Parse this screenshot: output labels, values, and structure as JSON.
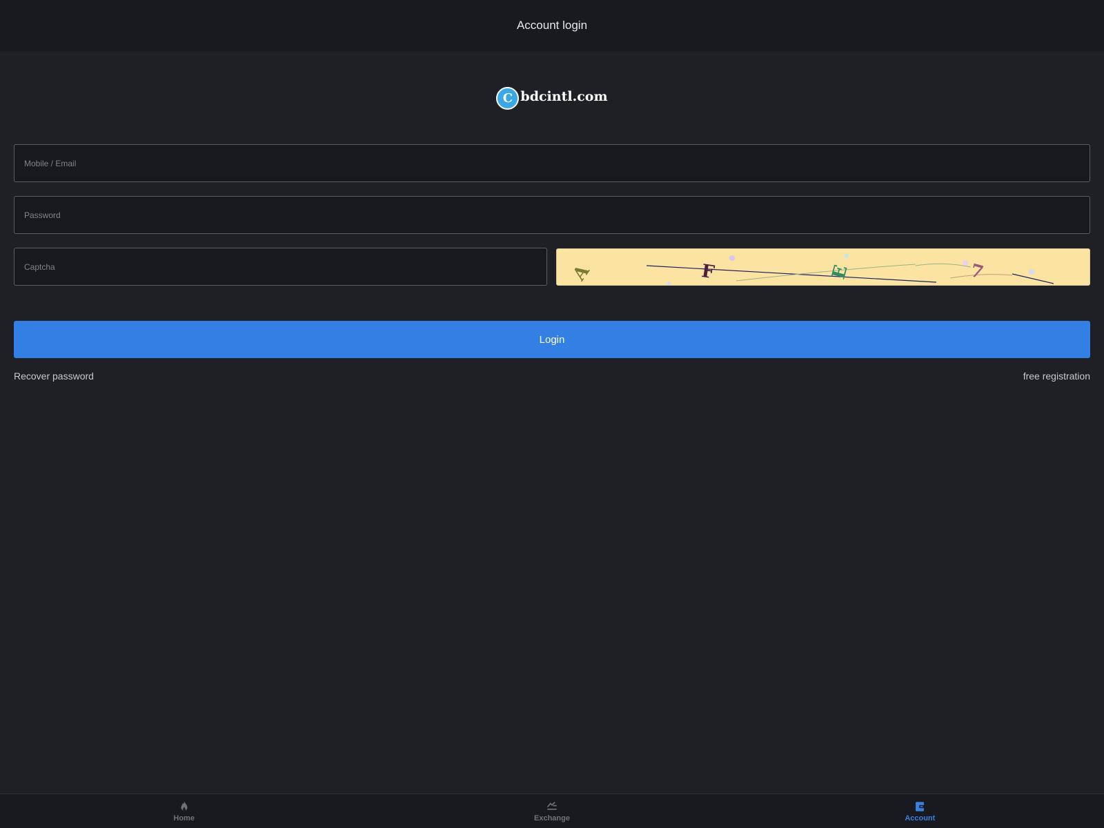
{
  "header": {
    "title": "Account login"
  },
  "logo": {
    "badge_letter": "C",
    "text": "bdcintl.com",
    "subtext": "ͫ̽̽̽̽ ̽̽̽"
  },
  "form": {
    "mobile_placeholder": "Mobile / Email",
    "password_placeholder": "Password",
    "captcha_placeholder": "Captcha",
    "captcha_chars": [
      "A",
      "F",
      "E",
      "7"
    ],
    "login_label": "Login"
  },
  "links": {
    "recover": "Recover password",
    "register": "free registration"
  },
  "tabbar": {
    "items": [
      {
        "label": "Home",
        "icon": "flame-icon",
        "active": false
      },
      {
        "label": "Exchange",
        "icon": "exchange-icon",
        "active": false
      },
      {
        "label": "Account",
        "icon": "wallet-icon",
        "active": true
      }
    ]
  },
  "colors": {
    "background": "#1f2026",
    "header": "#191a20",
    "accent": "#337fe3",
    "captcha_bg": "#fbe3a2"
  }
}
